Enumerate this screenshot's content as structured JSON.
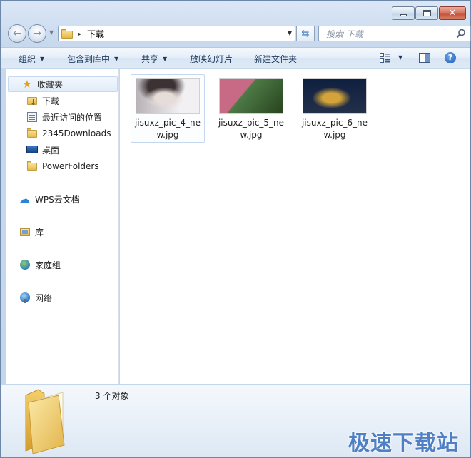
{
  "window": {
    "caption": {
      "minimize": "",
      "maximize": "",
      "close": "✕"
    }
  },
  "address_bar": {
    "current_folder": "下载",
    "separator": "▸"
  },
  "search": {
    "placeholder": "搜索 下载"
  },
  "toolbar": {
    "organize": "组织",
    "include_in_library": "包含到库中",
    "share": "共享",
    "slideshow": "放映幻灯片",
    "new_folder": "新建文件夹",
    "help": "?"
  },
  "sidebar": {
    "favorites": {
      "label": "收藏夹",
      "items": [
        {
          "label": "下载",
          "icon": "downloads-folder-icon"
        },
        {
          "label": "最近访问的位置",
          "icon": "recent-places-icon"
        },
        {
          "label": "2345Downloads",
          "icon": "folder-icon"
        },
        {
          "label": "桌面",
          "icon": "desktop-icon"
        },
        {
          "label": "PowerFolders",
          "icon": "folder-icon"
        }
      ]
    },
    "wps_cloud": "WPS云文档",
    "libraries": "库",
    "homegroup": "家庭组",
    "network": "网络"
  },
  "files": [
    {
      "name": "jisuxz_pic_4_new.jpg",
      "name_line1": "jisuxz_pic_4_ne",
      "name_line2": "w.jpg",
      "selected": true,
      "thumb_colors": [
        "#e6dcd8",
        "#b8b2b6",
        "#3c3234"
      ]
    },
    {
      "name": "jisuxz_pic_5_new.jpg",
      "name_line1": "jisuxz_pic_5_ne",
      "name_line2": "w.jpg",
      "selected": false,
      "thumb_colors": [
        "#c86a86",
        "#4d7a45",
        "#27431f"
      ]
    },
    {
      "name": "jisuxz_pic_6_new.jpg",
      "name_line1": "jisuxz_pic_6_ne",
      "name_line2": "w.jpg",
      "selected": false,
      "thumb_colors": [
        "#0f1f3f",
        "#d4a43a",
        "#23304a"
      ]
    }
  ],
  "details": {
    "item_count": "3 个对象"
  },
  "watermark": "极速下载站",
  "colors": {
    "accent": "#1e395b",
    "window_frame": "#c8d9ee",
    "selection": "#e1ecf9"
  }
}
